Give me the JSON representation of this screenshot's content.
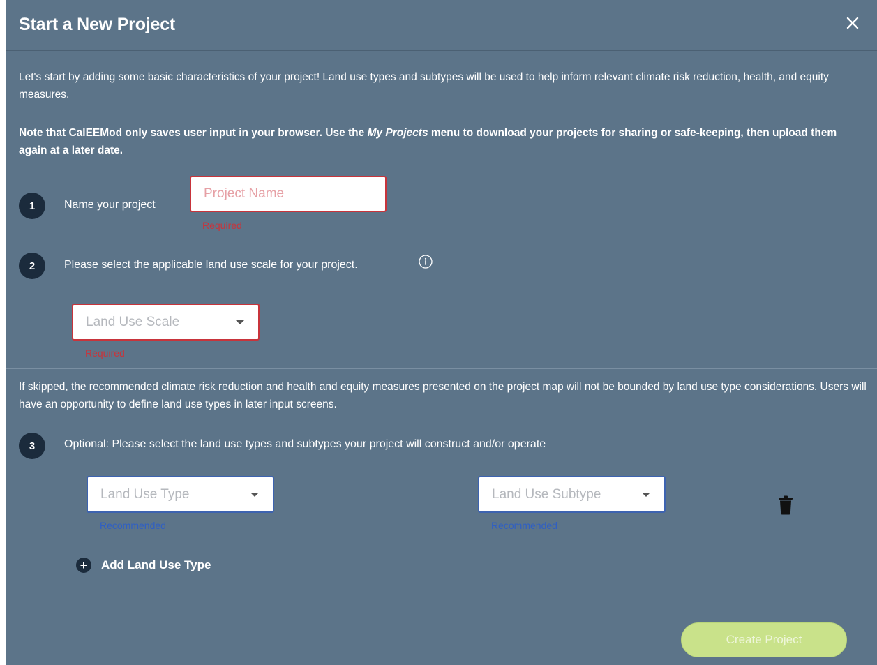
{
  "dialog": {
    "title": "Start a New Project",
    "intro": "Let's start by adding some basic characteristics of your project! Land use types and subtypes will be used to help inform relevant climate risk reduction, health, and equity measures.",
    "note_prefix": "Note that CalEEMod only saves user input in your browser. Use the ",
    "note_emphasis": "My Projects",
    "note_suffix": " menu to download your projects for sharing or safe-keeping, then upload them again at a later date."
  },
  "step1": {
    "number": "1",
    "label": "Name your project",
    "placeholder": "Project Name",
    "hint": "Required"
  },
  "step2": {
    "number": "2",
    "label": "Please select the applicable land use scale for your project.",
    "select_placeholder": "Land Use Scale",
    "hint": "Required"
  },
  "skip_note": "If skipped, the recommended climate risk reduction and health and equity measures presented on the project map will not be bounded by land use type considerations. Users will have an opportunity to define land use types in later input screens.",
  "step3": {
    "number": "3",
    "label": "Optional: Please select the land use types and subtypes your project will construct and/or operate",
    "type_placeholder": "Land Use Type",
    "type_hint": "Recommended",
    "subtype_placeholder": "Land Use Subtype",
    "subtype_hint": "Recommended",
    "add_label": "Add Land Use Type"
  },
  "actions": {
    "create_label": "Create Project"
  },
  "colors": {
    "background": "#5c7489",
    "step_circle": "#1b2b3c",
    "error": "#c8343b",
    "recommended": "#2f5fc4",
    "create_button": "#c9e28a"
  },
  "icons": {
    "close": "close-icon",
    "info": "info-icon",
    "caret": "chevron-down-icon",
    "trash": "trash-icon",
    "add": "plus-circle-icon"
  }
}
